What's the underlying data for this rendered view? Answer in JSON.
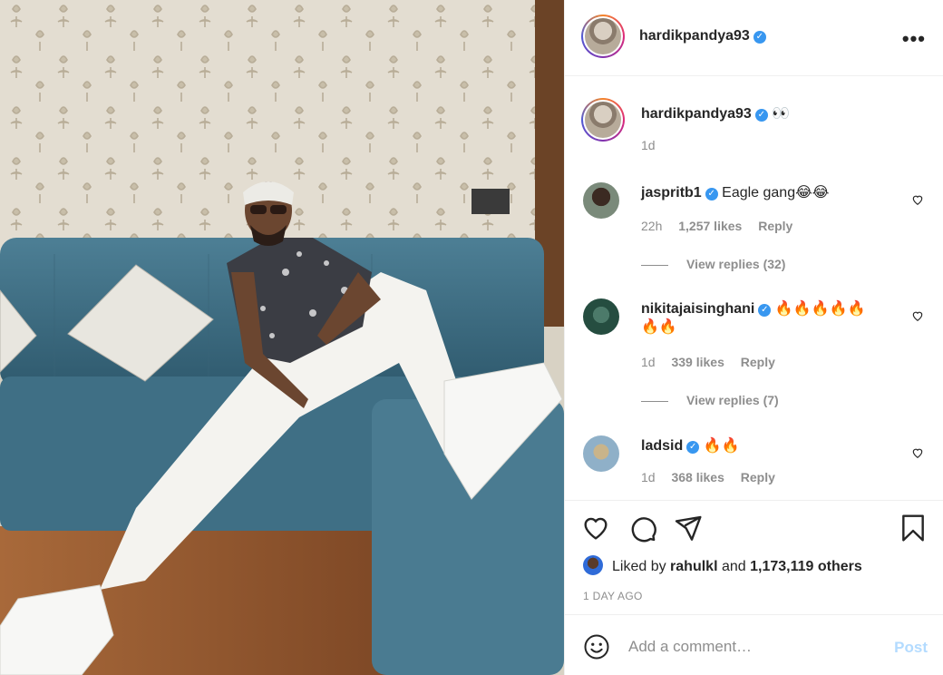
{
  "post": {
    "author": "hardikpandya93",
    "caption_emoji": "👀",
    "caption_time": "1d",
    "more_label": "•••"
  },
  "comments": [
    {
      "user": "jaspritb1",
      "text": "Eagle gang😂😂",
      "time": "22h",
      "likes": "1,257 likes",
      "reply": "Reply",
      "view_replies": "View replies (32)"
    },
    {
      "user": "nikitajaisinghani",
      "text": "🔥🔥🔥🔥🔥",
      "text2": "🔥🔥",
      "time": "1d",
      "likes": "339 likes",
      "reply": "Reply",
      "view_replies": "View replies (7)"
    },
    {
      "user": "ladsid",
      "text": "🔥🔥",
      "time": "1d",
      "likes": "368 likes",
      "reply": "Reply"
    }
  ],
  "likes": {
    "prefix": "Liked by",
    "user": "rahulkl",
    "and": "and",
    "others": "1,173,119 others"
  },
  "timestamp": "1 DAY AGO",
  "add_comment": {
    "placeholder": "Add a comment…",
    "post_label": "Post"
  },
  "colors": {
    "verified": "#3897f0",
    "post_disabled": "#b3dbff",
    "muted": "#8e8e8e"
  },
  "icons": [
    "heart-icon",
    "comment-icon",
    "share-icon",
    "bookmark-icon",
    "emoji-icon",
    "verified-icon",
    "more-icon"
  ]
}
